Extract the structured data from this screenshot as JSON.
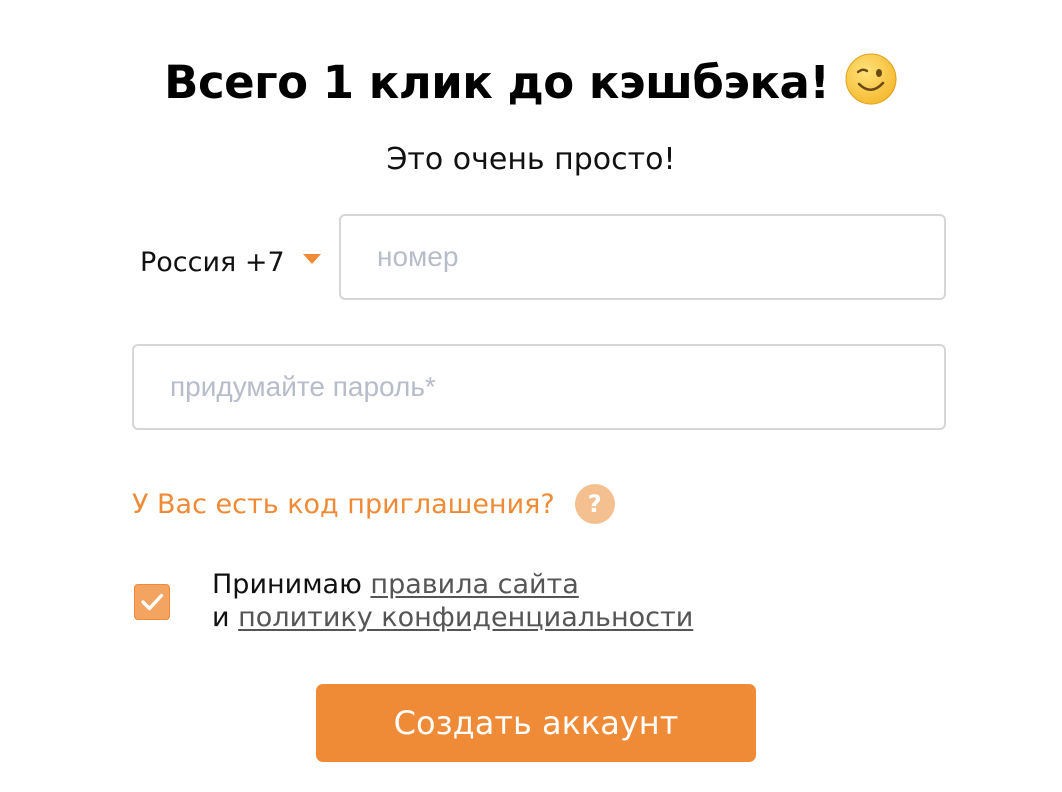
{
  "header": {
    "title": "Всего 1 клик до кэшбэка!",
    "emoji_icon": "winking-face-icon",
    "subtitle": "Это очень просто!"
  },
  "phone": {
    "country_label": "Россия +7",
    "dropdown_icon": "caret-down-icon",
    "placeholder": "номер",
    "value": ""
  },
  "password": {
    "placeholder": "придумайте пароль*",
    "value": ""
  },
  "invite": {
    "label": "У Вас есть код приглашения?",
    "help_icon": "question-icon",
    "help_glyph": "?"
  },
  "terms": {
    "checked": true,
    "prefix": "Принимаю ",
    "rules_link": "правила сайта",
    "conjunction": "и ",
    "privacy_link": "политику конфиденциальности"
  },
  "submit": {
    "label": "Создать аккаунт"
  },
  "colors": {
    "accent": "#ef8a37",
    "help_circle": "#f5c08f",
    "input_border": "#d6d6d6",
    "placeholder": "#b7bcc9"
  }
}
